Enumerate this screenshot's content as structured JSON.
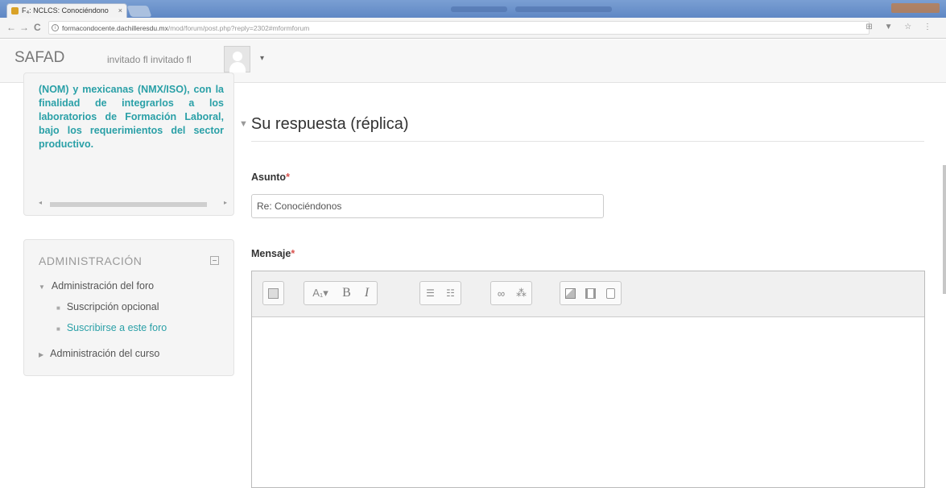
{
  "browser": {
    "tab_title": "F₄: NCLCS: Conociéndono",
    "tab_close": "×",
    "url_host": "formacondocente.dachilleresdu.mx",
    "url_path": "/mod/forum/post.php?reply=2302#mformforum",
    "nav_back": "←",
    "nav_forward": "→",
    "nav_reload": "C",
    "toolbar_icons": "⊞ ▼ ☆ ⋮"
  },
  "navbar": {
    "brand": "SAFAD",
    "user": "invitado fl invitado fl",
    "caret": "▾"
  },
  "sidebar": {
    "summary_text": "(NOM) y mexicanas (NMX/ISO), con la finalidad de integrarlos a los laboratorios de Formación Laboral, bajo los requerimientos del sector productivo.",
    "admin": {
      "title": "ADMINISTRACIÓN",
      "forum_admin": "Administración del foro",
      "optional_subscription": "Suscripción opcional",
      "subscribe": "Suscribirse a este foro",
      "course_admin": "Administración del curso"
    }
  },
  "main": {
    "reply_heading": "Su respuesta (réplica)",
    "subject_label": "Asunto",
    "subject_value": "Re: Conociéndonos",
    "message_label": "Mensaje",
    "required_mark": "*"
  },
  "editor": {
    "buttons": [
      "toolbar-toggle",
      "text-style",
      "bold",
      "italic",
      "unordered-list",
      "ordered-list",
      "link",
      "unlink",
      "image",
      "media",
      "manage-files"
    ],
    "style_label": "A₁▾",
    "bold_label": "B",
    "italic_label": "I"
  },
  "colors": {
    "accent": "#2aa0a7",
    "required": "#d9534f"
  }
}
